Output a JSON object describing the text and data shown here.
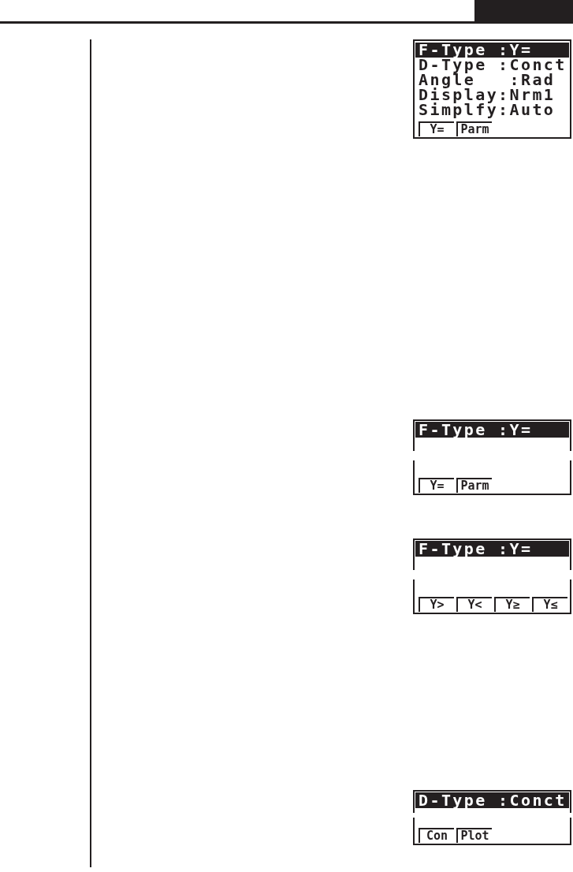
{
  "screens": [
    {
      "kind": "full",
      "rows": [
        {
          "text": "F-Type :Y=",
          "selected": true
        },
        {
          "text": "D-Type :Conct",
          "selected": false
        },
        {
          "text": "Angle   :Rad",
          "selected": false
        },
        {
          "text": "Display:Nrm1",
          "selected": false
        },
        {
          "text": "Simplfy:Auto",
          "selected": false
        }
      ],
      "function_keys": [
        "Y=",
        "Parm"
      ]
    },
    {
      "kind": "split",
      "rows": [
        {
          "text": "F-Type :Y=",
          "selected": true
        }
      ],
      "function_keys": [
        "Y=",
        "Parm"
      ]
    },
    {
      "kind": "split",
      "rows": [
        {
          "text": "F-Type :Y=",
          "selected": true
        }
      ],
      "function_keys": [
        "Y>",
        "Y<",
        "Y≥",
        "Y≤"
      ]
    },
    {
      "kind": "split",
      "rows": [
        {
          "text": "D-Type :Conct",
          "selected": true
        }
      ],
      "function_keys": [
        "Con",
        "Plot"
      ]
    }
  ]
}
